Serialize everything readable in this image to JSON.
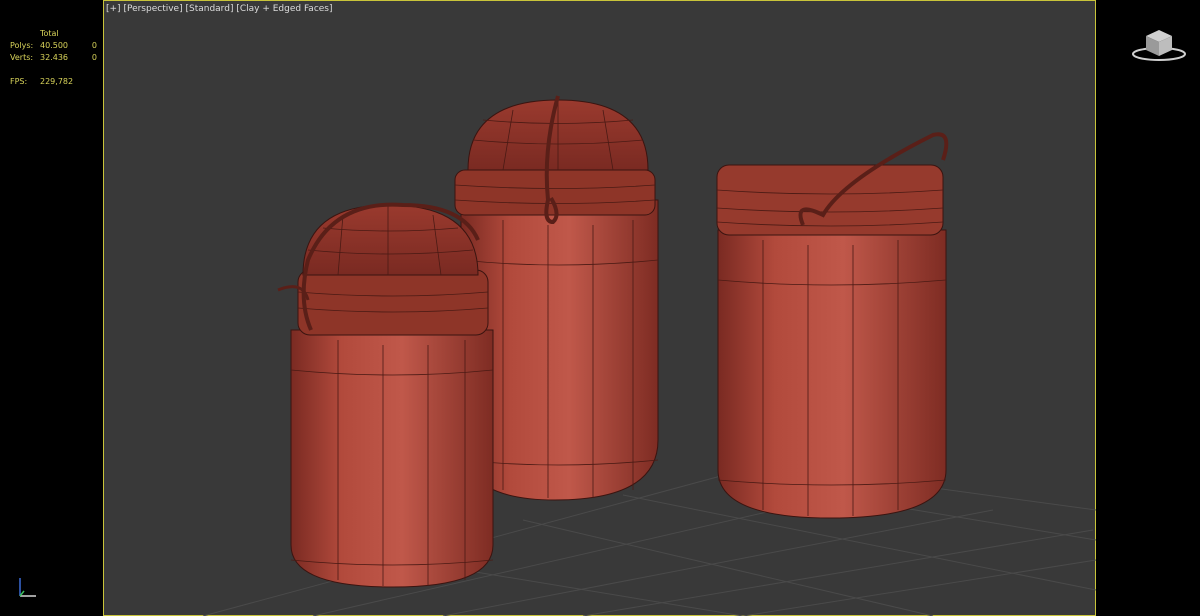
{
  "viewport": {
    "label_plus": "[+]",
    "label_view": "[Perspective]",
    "label_shading": "[Standard]",
    "label_mode": "[Clay + Edged Faces]"
  },
  "stats": {
    "header": "Total",
    "polys_label": "Polys:",
    "polys_value": "40.500",
    "polys_sel": "0",
    "verts_label": "Verts:",
    "verts_value": "32.436",
    "verts_sel": "0",
    "fps_label": "FPS:",
    "fps_value": "229,782"
  },
  "colors": {
    "viewport_bg": "#393939",
    "border_active": "#c9c43a",
    "stats_text": "#d9d45a",
    "clay": "#b0473a"
  },
  "icons": {
    "viewcube": "viewcube-icon",
    "axis": "axis-tripod-icon"
  }
}
